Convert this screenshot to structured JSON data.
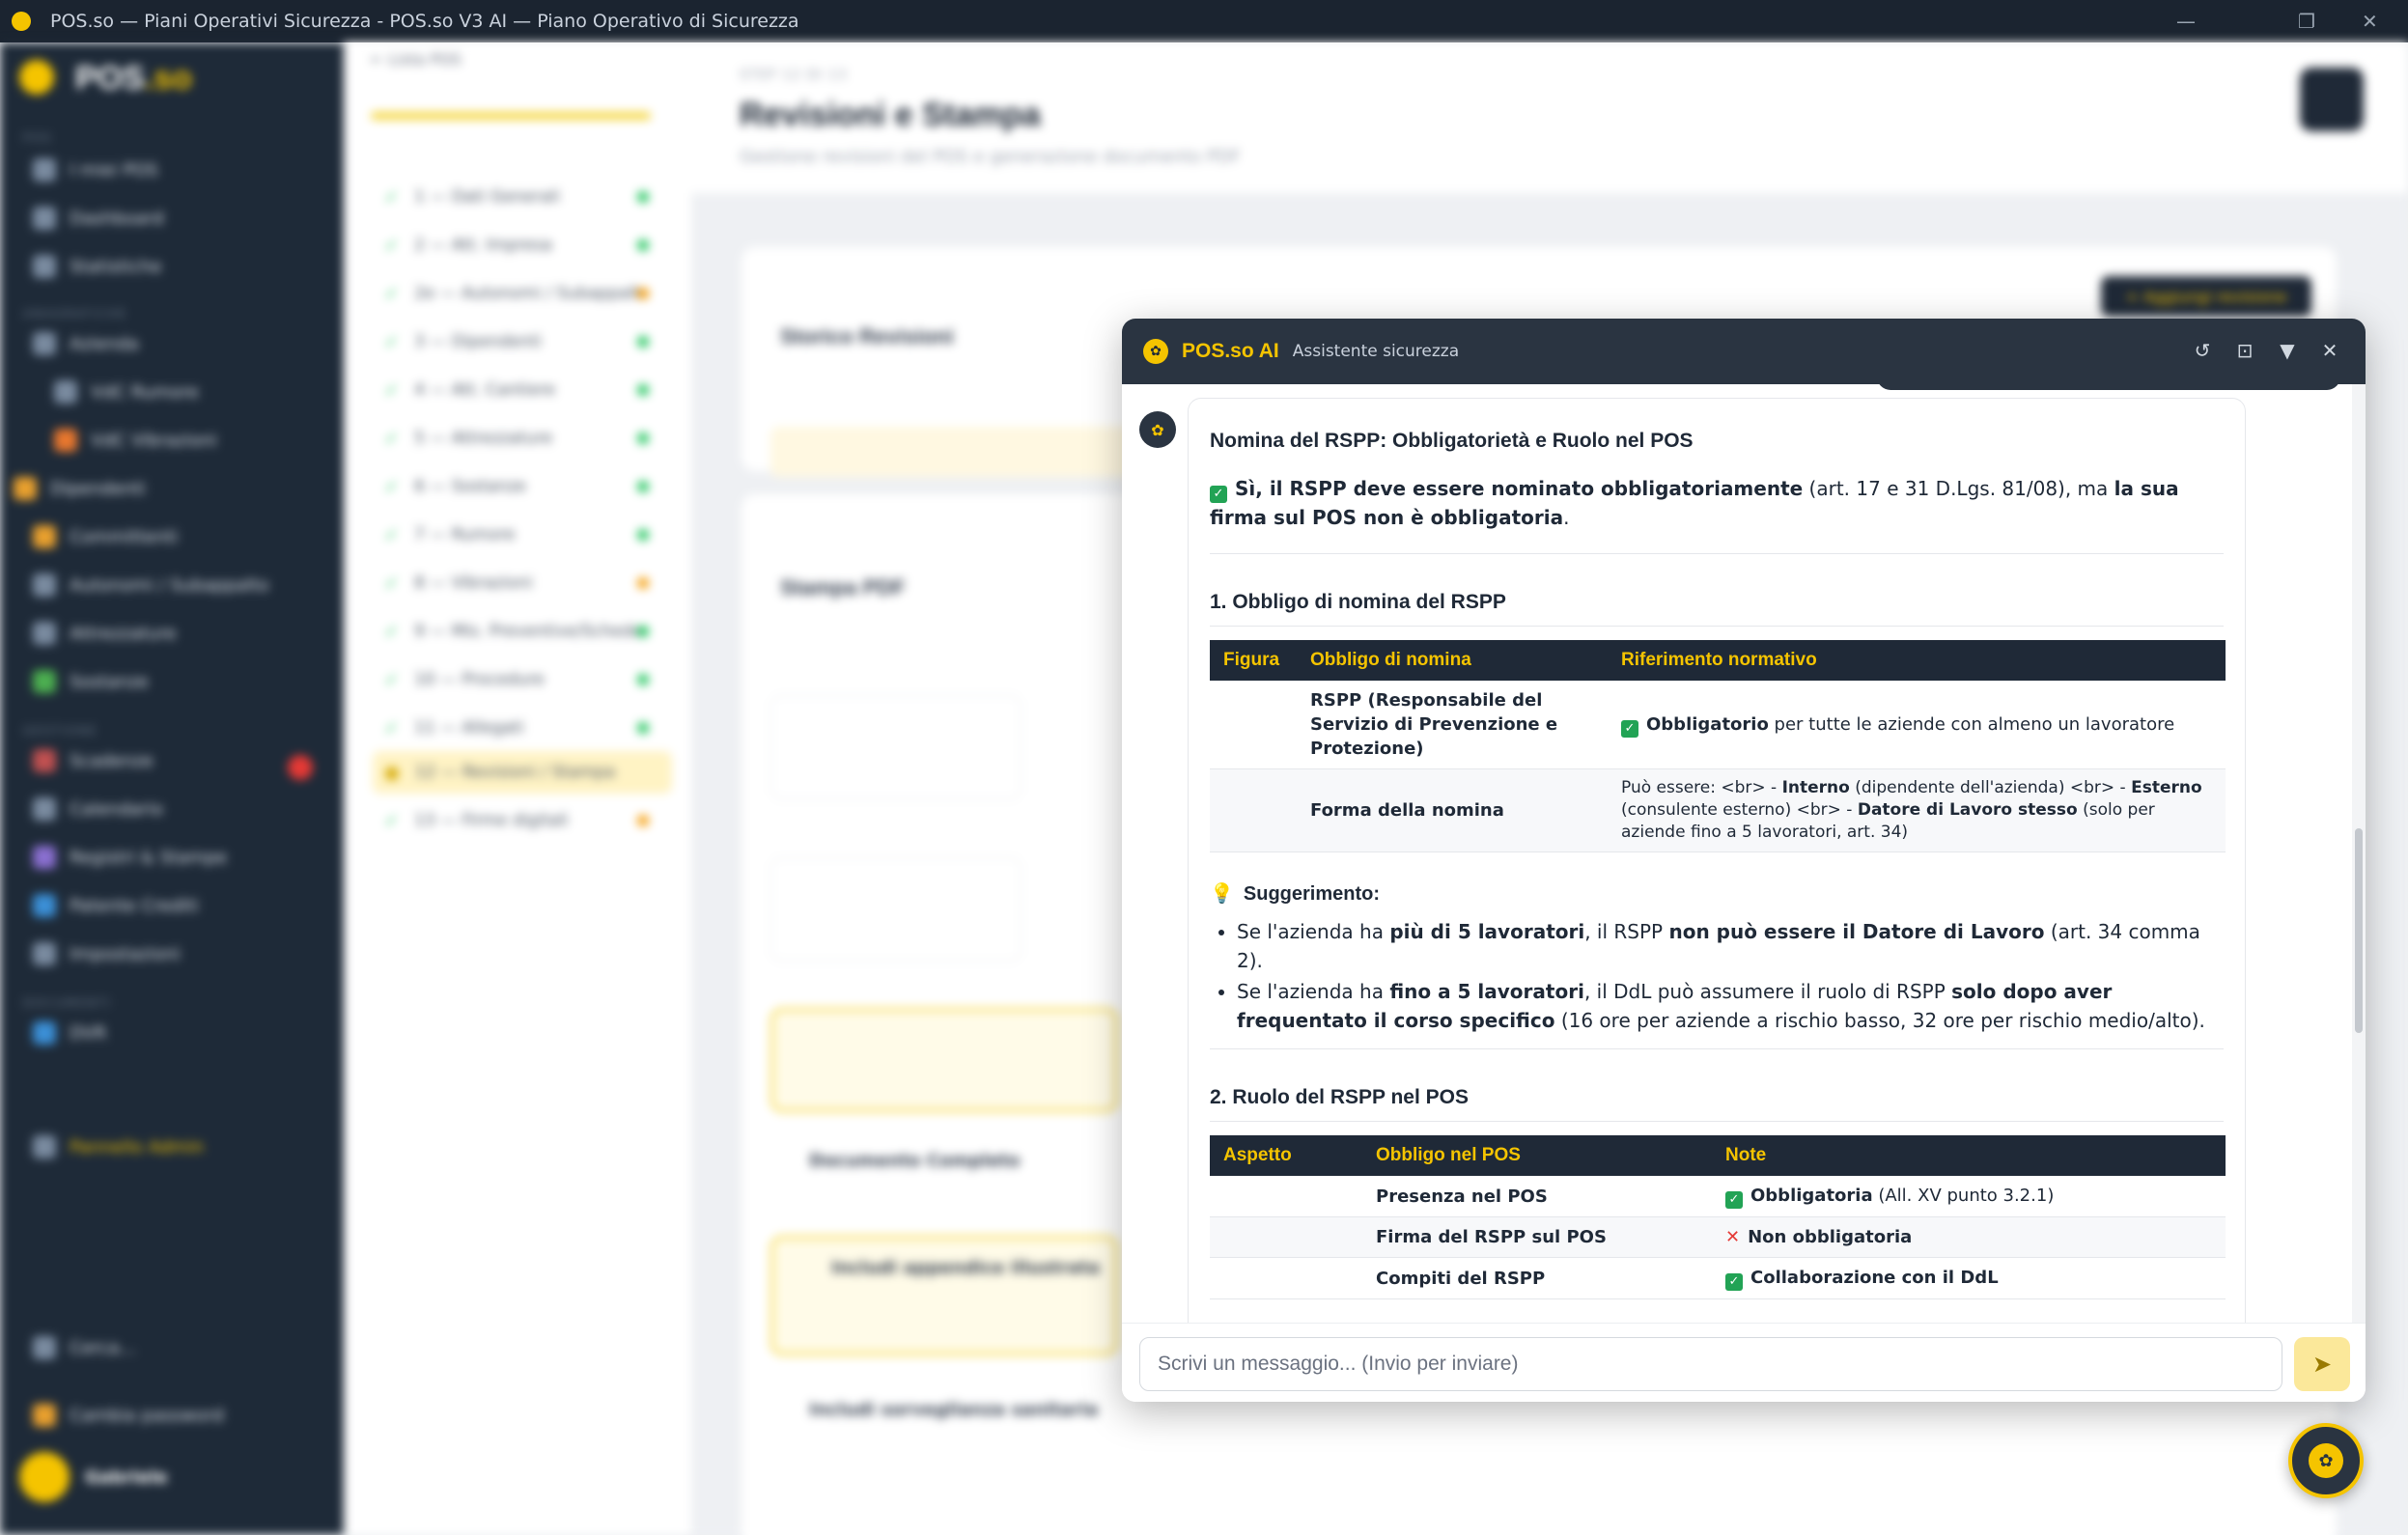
{
  "window": {
    "title": "POS.so — Piani Operativi Sicurezza - POS.so V3 AI — Piano Operativo di Sicurezza"
  },
  "sidebar": {
    "brand_main": "POS",
    "brand_accent": ".so",
    "items": [
      {
        "label": "I miei POS"
      },
      {
        "label": "Dashboard"
      },
      {
        "label": "Statistiche"
      },
      {
        "label": "Azienda"
      },
      {
        "label": "VdC Rumore"
      },
      {
        "label": "VdC Vibrazioni"
      },
      {
        "label": "Dipendenti"
      },
      {
        "label": "Committenti"
      },
      {
        "label": "Autonomi / Subappalto"
      },
      {
        "label": "Attrezzature"
      },
      {
        "label": "Sostanze"
      },
      {
        "label": "Scadenze"
      },
      {
        "label": "Calendario"
      },
      {
        "label": "Registri & Stampe"
      },
      {
        "label": "Patente Crediti"
      },
      {
        "label": "Impostazioni"
      },
      {
        "label": "DVR"
      },
      {
        "label": "Pannello Admin"
      }
    ],
    "search_label": "Cerca...",
    "password_label": "Cambia password",
    "user_name": "Gabriele"
  },
  "steps": {
    "back_label": "← Lista POS",
    "items": [
      {
        "label": "1 — Dati Generali"
      },
      {
        "label": "2 — Att. Impresa"
      },
      {
        "label": "2e — Autonomi / Subappalto"
      },
      {
        "label": "3 — Dipendenti"
      },
      {
        "label": "4 — Att. Cantiere"
      },
      {
        "label": "5 — Attrezzature"
      },
      {
        "label": "6 — Sostanze"
      },
      {
        "label": "7 — Rumore"
      },
      {
        "label": "8 — Vibrazioni"
      },
      {
        "label": "9 — Mis. Preventive/Schede"
      },
      {
        "label": "10 — Procedure"
      },
      {
        "label": "11 — Allegati"
      },
      {
        "label": "12 — Revisioni / Stampa"
      },
      {
        "label": "13 — Firme digitali"
      }
    ]
  },
  "main": {
    "step_caption": "STEP 12 DI 13",
    "title": "Revisioni e Stampa",
    "subtitle": "Gestione revisioni del POS e generazione documento PDF",
    "revisions_title": "Storico Revisioni",
    "add_revision_label": "+ Aggiungi revisione",
    "print_title": "Stampa PDF",
    "doc_complete": "Documento Completo",
    "appendix_label": "Includi appendice illustrata",
    "health_label": "Includi sorveglianza sanitaria"
  },
  "chat": {
    "title": "POS.so AI",
    "subtitle": "Assistente sicurezza",
    "message": {
      "title": "Nomina del RSPP: Obbligatorietà e Ruolo nel POS",
      "intro": {
        "b1": "Sì, il RSPP deve essere nominato obbligatoriamente",
        "t1": " (art. 17 e 31 D.Lgs. 81/08), ma ",
        "b2": "la sua firma sul POS non è obbligatoria",
        "t2": "."
      },
      "section1": {
        "heading": "1. Obbligo di nomina del RSPP",
        "headers": [
          "Figura",
          "Obbligo di nomina",
          "Riferimento normativo"
        ],
        "row1": {
          "col1": "",
          "col2": "RSPP (Responsabile del Servizio di Prevenzione e Protezione)",
          "col3_b": "Obbligatorio",
          "col3_t": " per tutte le aziende con almeno un lavoratore"
        },
        "row2": {
          "col1": "",
          "col2": "Forma della nomina",
          "t1": "Può essere: <br> - ",
          "b1": "Interno",
          "t2": " (dipendente dell'azienda) <br> - ",
          "b2": "Esterno",
          "t3": " (consulente esterno) <br> - ",
          "b3": "Datore di Lavoro stesso",
          "t4": " (solo per aziende fino a 5 lavoratori, art. 34)"
        }
      },
      "tip": {
        "label": "Suggerimento:",
        "bullet1": {
          "t1": "Se l'azienda ha ",
          "b1": "più di 5 lavoratori",
          "t2": ", il RSPP ",
          "b2": "non può essere il Datore di Lavoro",
          "t3": " (art. 34 comma 2)."
        },
        "bullet2": {
          "t1": "Se l'azienda ha ",
          "b1": "fino a 5 lavoratori",
          "t2": ", il DdL può assumere il ruolo di RSPP ",
          "b2": "solo dopo aver frequentato il corso specifico",
          "t3": " (16 ore per aziende a rischio basso, 32 ore per rischio medio/alto)."
        }
      },
      "section2": {
        "heading": "2. Ruolo del RSPP nel POS",
        "headers": [
          "Aspetto",
          "Obbligo nel POS",
          "Note"
        ],
        "rows": [
          {
            "col1": "",
            "col2": "Presenza nel POS",
            "note_b": "Obbligatoria",
            "note_t": " (All. XV punto 3.2.1)"
          },
          {
            "col1": "",
            "col2": "Firma del RSPP sul POS",
            "note_b": "Non obbligatoria",
            "note_t": ""
          },
          {
            "col1": "",
            "col2": "Compiti del RSPP",
            "note_b": "Collaborazione con il DdL",
            "note_t": ""
          }
        ]
      }
    },
    "input_placeholder": "Scrivi un messaggio... (Invio per inviare)"
  }
}
